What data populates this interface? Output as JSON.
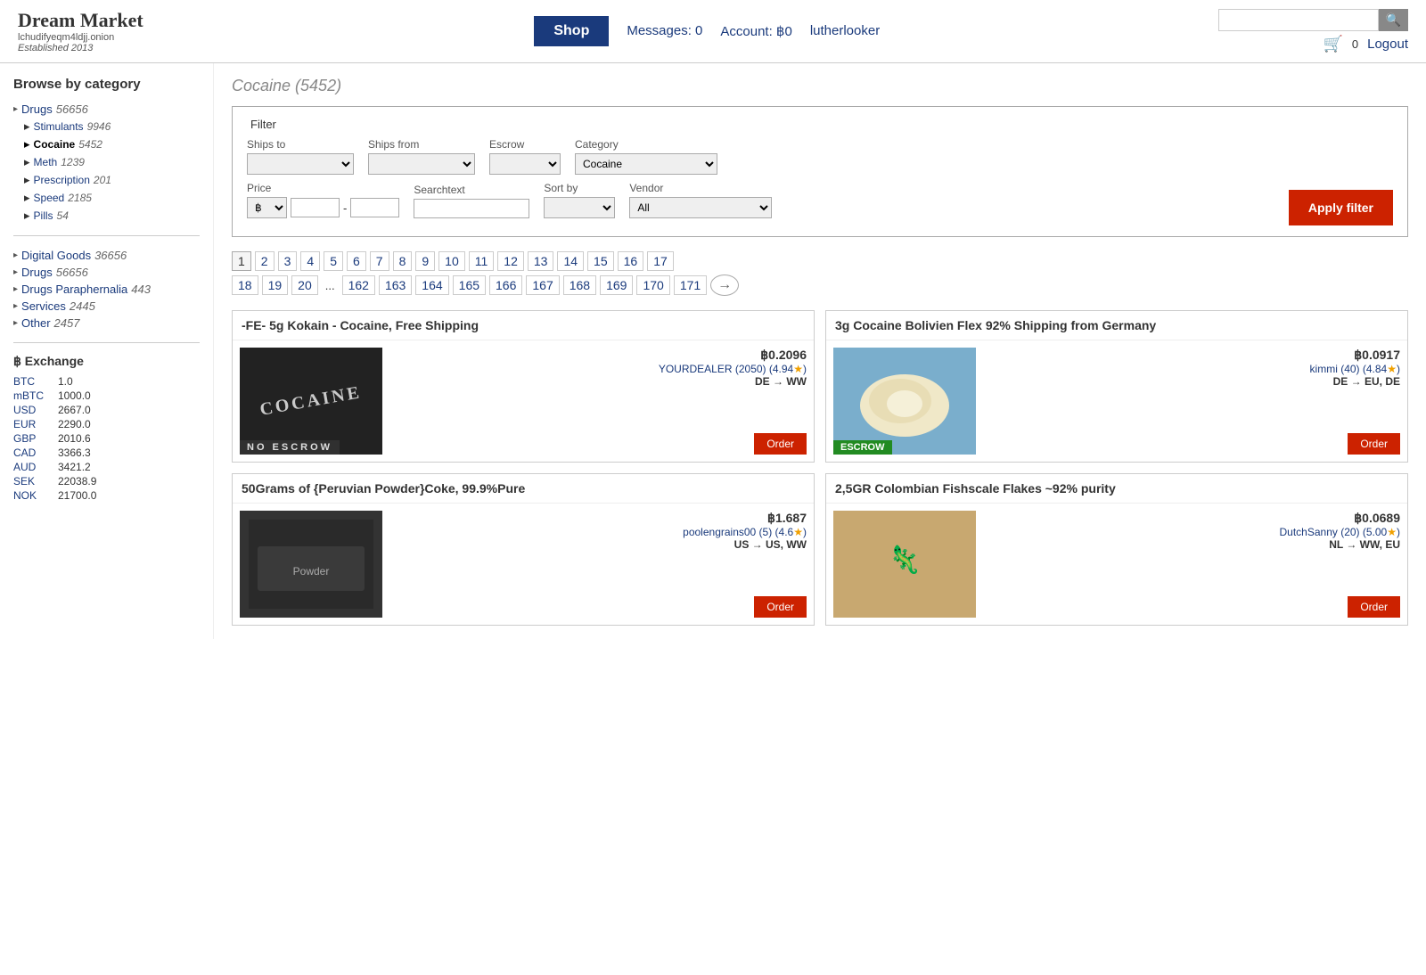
{
  "header": {
    "logo": {
      "title": "Dream Market",
      "subtitle": "lchudifyeqm4ldjj.onion",
      "established": "Established 2013"
    },
    "nav": {
      "shop": "Shop",
      "messages": "Messages: 0",
      "account": "Account: ฿0",
      "username": "lutherlooker"
    },
    "search": {
      "placeholder": "",
      "button": "🔍"
    },
    "cart_count": "0",
    "logout": "Logout"
  },
  "sidebar": {
    "browse_title": "Browse by category",
    "categories": [
      {
        "name": "Drugs",
        "count": "56656",
        "active": false
      },
      {
        "name": "Stimulants",
        "count": "9946",
        "active": false,
        "indent": true
      },
      {
        "name": "Cocaine",
        "count": "5452",
        "active": true,
        "indent": true
      },
      {
        "name": "Meth",
        "count": "1239",
        "active": false,
        "indent": true
      },
      {
        "name": "Prescription",
        "count": "201",
        "active": false,
        "indent": true
      },
      {
        "name": "Speed",
        "count": "2185",
        "active": false,
        "indent": true
      },
      {
        "name": "Pills",
        "count": "54",
        "active": false,
        "indent": true
      }
    ],
    "categories2": [
      {
        "name": "Digital Goods",
        "count": "36656"
      },
      {
        "name": "Drugs",
        "count": "56656"
      },
      {
        "name": "Drugs Paraphernalia",
        "count": "443"
      },
      {
        "name": "Services",
        "count": "2445"
      },
      {
        "name": "Other",
        "count": "2457"
      }
    ],
    "exchange_title": "฿ Exchange",
    "exchange": [
      {
        "currency": "BTC",
        "rate": "1.0"
      },
      {
        "currency": "mBTC",
        "rate": "1000.0"
      },
      {
        "currency": "USD",
        "rate": "2667.0"
      },
      {
        "currency": "EUR",
        "rate": "2290.0"
      },
      {
        "currency": "GBP",
        "rate": "2010.6"
      },
      {
        "currency": "CAD",
        "rate": "3366.3"
      },
      {
        "currency": "AUD",
        "rate": "3421.2"
      },
      {
        "currency": "SEK",
        "rate": "22038.9"
      },
      {
        "currency": "NOK",
        "rate": "21700.0"
      }
    ]
  },
  "content": {
    "heading": "Cocaine (5452)",
    "filter": {
      "legend": "Filter",
      "ships_to_label": "Ships to",
      "ships_from_label": "Ships from",
      "escrow_label": "Escrow",
      "category_label": "Category",
      "category_value": "Cocaine",
      "price_label": "Price",
      "price_currency": "฿",
      "searchtext_label": "Searchtext",
      "sort_by_label": "Sort by",
      "vendor_label": "Vendor",
      "vendor_value": "All",
      "apply_btn": "Apply filter"
    },
    "pagination": {
      "pages_row1": [
        "1",
        "2",
        "3",
        "4",
        "5",
        "6",
        "7",
        "8",
        "9",
        "10",
        "11",
        "12",
        "13",
        "14",
        "15",
        "16",
        "17"
      ],
      "pages_row2": [
        "18",
        "19",
        "20",
        "...",
        "162",
        "163",
        "164",
        "165",
        "166",
        "167",
        "168",
        "169",
        "170",
        "171"
      ]
    },
    "products": [
      {
        "title": "-FE- 5g Kokain - Cocaine, Free Shipping",
        "price": "฿0.2096",
        "vendor": "YOURDEALER (2050) (4.94★)",
        "shipping": "DE → WW",
        "badge": "NO ESCROW",
        "badge_type": "no-escrow",
        "img_text": "COCAINE"
      },
      {
        "title": "3g Cocaine Bolivien Flex 92% Shipping from Germany",
        "price": "฿0.0917",
        "vendor": "kimmi (40) (4.84★)",
        "shipping": "DE → EU, DE",
        "badge": "ESCROW",
        "badge_type": "escrow",
        "img_text": ""
      },
      {
        "title": "50Grams of {Peruvian Powder}Coke, 99.9%Pure",
        "price": "฿1.687",
        "vendor": "poolengrains00 (5) (4.6★)",
        "shipping": "US → US, WW",
        "badge": "",
        "badge_type": "",
        "img_text": ""
      },
      {
        "title": "2,5GR Colombian Fishscale Flakes ~92% purity",
        "price": "฿0.0689",
        "vendor": "DutchSanny (20) (5.00★)",
        "shipping": "NL → WW, EU",
        "badge": "",
        "badge_type": "",
        "img_text": ""
      }
    ]
  }
}
